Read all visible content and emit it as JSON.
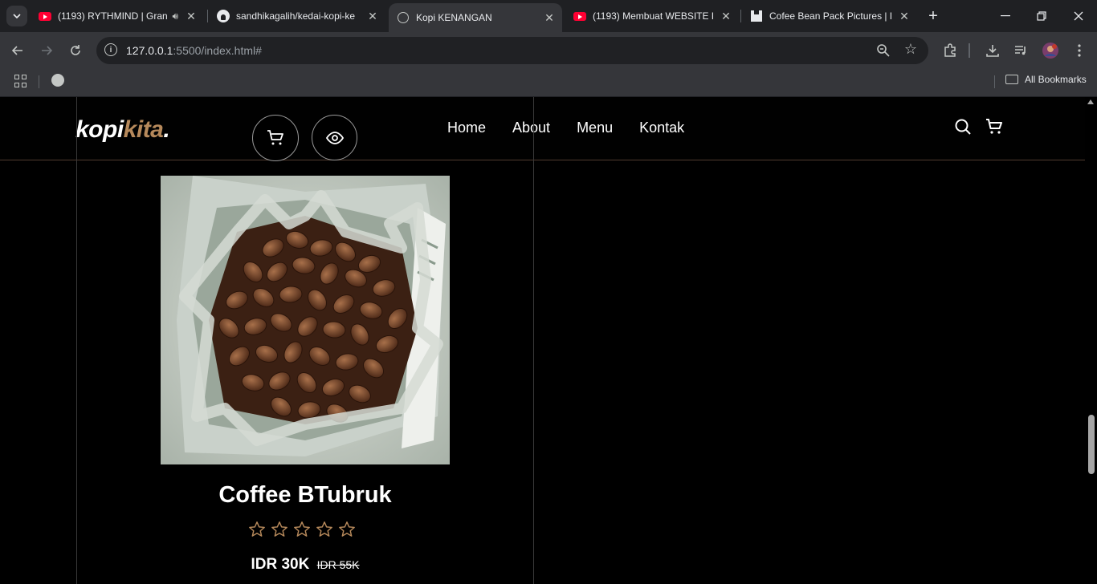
{
  "browser": {
    "tabs": [
      {
        "title": "(1193) RYTHMIND | Gran",
        "favicon": "youtube-icon",
        "audio": true
      },
      {
        "title": "sandhikagalih/kedai-kopi-ke",
        "favicon": "github-icon"
      },
      {
        "title": "Kopi KENANGAN",
        "favicon": "globe-icon",
        "active": true
      },
      {
        "title": "(1193) Membuat WEBSITE K",
        "favicon": "youtube-icon"
      },
      {
        "title": "Cofee Bean Pack Pictures | D",
        "favicon": "unsplash-icon"
      }
    ],
    "url_host": "127.0.0.1",
    "url_path": ":5500/index.html#",
    "bookmarks_label": "All Bookmarks"
  },
  "site": {
    "logo_main": "kopi",
    "logo_accent": "kita",
    "logo_dot": ".",
    "nav": [
      "Home",
      "About",
      "Menu",
      "Kontak"
    ]
  },
  "product": {
    "title": "Coffee BTubruk",
    "rating": 0,
    "max_rating": 5,
    "price": "IDR 30K",
    "old_price": "IDR 55K"
  },
  "colors": {
    "accent": "#b6895b",
    "background": "#010101"
  }
}
